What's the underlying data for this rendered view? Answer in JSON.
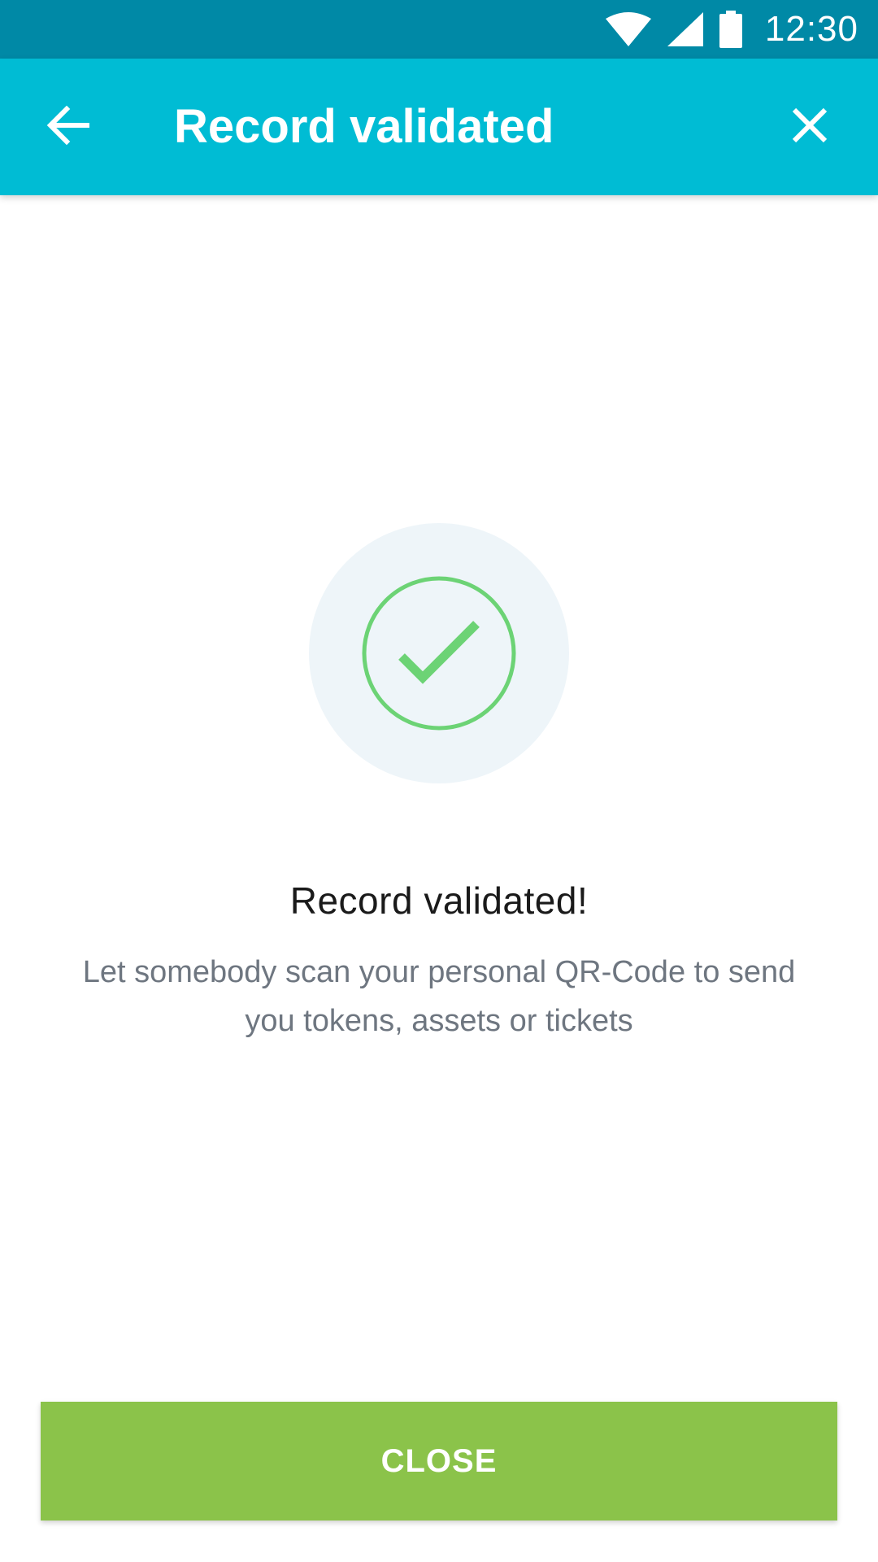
{
  "status_bar": {
    "time": "12:30",
    "icons": [
      "wifi-icon",
      "cellular-signal-icon",
      "battery-icon"
    ],
    "background_color": "#0089A6"
  },
  "app_bar": {
    "title": "Record validated",
    "back_icon": "arrow-back-icon",
    "close_icon": "close-icon",
    "background_color": "#00BCD4"
  },
  "success": {
    "icon": "checkmark-circle-icon",
    "accent_color": "#6CD375",
    "circle_background": "#EEF5F9",
    "headline": "Record validated!",
    "message": "Let somebody scan your personal QR-Code to send you tokens, assets or tickets"
  },
  "footer": {
    "close_label": "CLOSE",
    "button_color": "#8BC34A"
  }
}
